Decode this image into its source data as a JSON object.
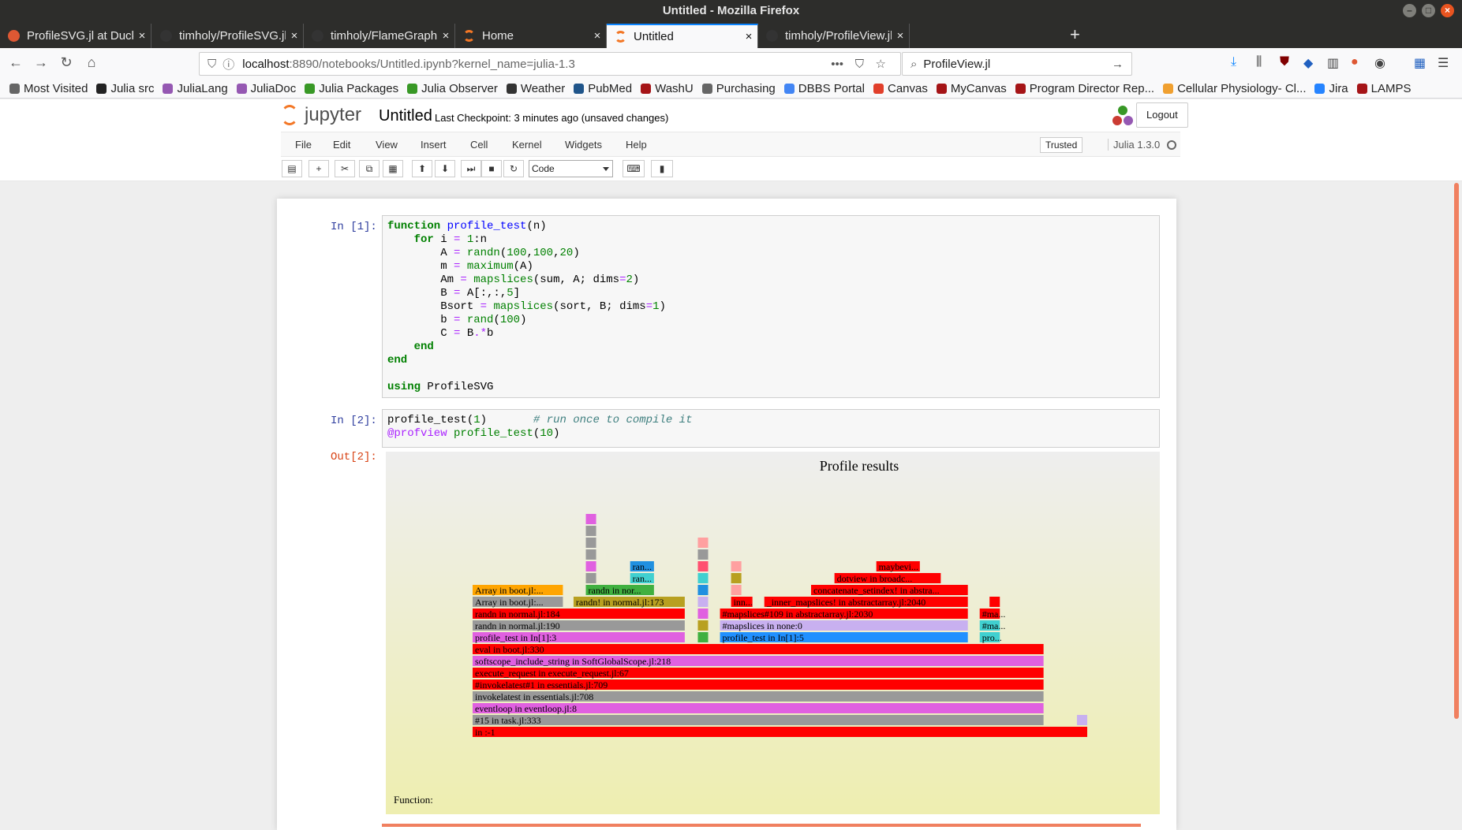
{
  "window": {
    "title": "Untitled - Mozilla Firefox"
  },
  "tabs": [
    {
      "label": "ProfileSVG.jl at DuckDuc",
      "icon": "duckduckgo-icon",
      "color": "#de5833"
    },
    {
      "label": "timholy/ProfileSVG.jl: W",
      "icon": "github-icon",
      "color": "#333333"
    },
    {
      "label": "timholy/FlameGraphs.jl:",
      "icon": "github-icon",
      "color": "#333333"
    },
    {
      "label": "Home",
      "icon": "jupyter-icon",
      "color": "#f37726"
    },
    {
      "label": "Untitled",
      "icon": "jupyter-icon",
      "color": "#f37726",
      "active": true
    },
    {
      "label": "timholy/ProfileView.jl: V",
      "icon": "github-icon",
      "color": "#333333"
    }
  ],
  "nav": {
    "url_host": "localhost",
    "url_rest": ":8890/notebooks/Untitled.ipynb?kernel_name=julia-1.3",
    "search_value": "ProfileView.jl"
  },
  "bookmarks": [
    {
      "label": "Most Visited",
      "color": "#666666"
    },
    {
      "label": "Julia src",
      "color": "#222222"
    },
    {
      "label": "JuliaLang",
      "color": "#9558b2"
    },
    {
      "label": "JuliaDoc",
      "color": "#9558b2"
    },
    {
      "label": "Julia Packages",
      "color": "#389826"
    },
    {
      "label": "Julia Observer",
      "color": "#389826"
    },
    {
      "label": "Weather",
      "color": "#333333"
    },
    {
      "label": "PubMed",
      "color": "#20558a"
    },
    {
      "label": "WashU",
      "color": "#a51417"
    },
    {
      "label": "Purchasing",
      "color": "#666666"
    },
    {
      "label": "DBBS Portal",
      "color": "#4285f4"
    },
    {
      "label": "Canvas",
      "color": "#e13f2b"
    },
    {
      "label": "MyCanvas",
      "color": "#a51417"
    },
    {
      "label": "Program Director Rep...",
      "color": "#a51417"
    },
    {
      "label": "Cellular Physiology- Cl...",
      "color": "#f0a030"
    },
    {
      "label": "Jira",
      "color": "#2684ff"
    },
    {
      "label": "LAMPS",
      "color": "#a51417"
    }
  ],
  "jupyter": {
    "logo_text": "jupyter",
    "notebook_name": "Untitled",
    "checkpoint": "Last Checkpoint: 3 minutes ago (unsaved changes)",
    "logout": "Logout",
    "menus": [
      "File",
      "Edit",
      "View",
      "Insert",
      "Cell",
      "Kernel",
      "Widgets",
      "Help"
    ],
    "trusted": "Trusted",
    "kernel": "Julia 1.3.0",
    "cell_type": "Code"
  },
  "cells": {
    "c1_prompt": "In [1]:",
    "c2_prompt": "In [2]:",
    "out_prompt": "Out[2]:"
  },
  "chart_data": {
    "type": "flamegraph",
    "title": "Profile results",
    "footer": "Function:",
    "frames": [
      {
        "label": "in :-1",
        "level": 0,
        "start": 0,
        "end": 100,
        "color": "#ff0000"
      },
      {
        "label": "#15 in task.jl:333",
        "level": 1,
        "start": 0,
        "end": 92.9,
        "color": "#999999"
      },
      {
        "label": "eventloop in eventloop.jl:8",
        "level": 2,
        "start": 0,
        "end": 92.9,
        "color": "#e060e0"
      },
      {
        "label": "invokelatest in essentials.jl:708",
        "level": 3,
        "start": 0,
        "end": 92.9,
        "color": "#999999"
      },
      {
        "label": "#invokelatest#1 in essentials.jl:709",
        "level": 4,
        "start": 0,
        "end": 92.9,
        "color": "#ff0000"
      },
      {
        "label": "execute_request in execute_request.jl:67",
        "level": 5,
        "start": 0,
        "end": 92.9,
        "color": "#ff0000"
      },
      {
        "label": "softscope_include_string in SoftGlobalScope.jl:218",
        "level": 6,
        "start": 0,
        "end": 92.9,
        "color": "#e060e0"
      },
      {
        "label": "eval in boot.jl:330",
        "level": 7,
        "start": 0,
        "end": 92.9,
        "color": "#ff0000"
      },
      {
        "label": "profile_test in In[1]:3",
        "level": 8,
        "start": 0,
        "end": 34.6,
        "color": "#e060e0"
      },
      {
        "label": "randn in normal.jl:190",
        "level": 9,
        "start": 0,
        "end": 34.6,
        "color": "#999999"
      },
      {
        "label": "randn in normal.jl:184",
        "level": 10,
        "start": 0,
        "end": 34.6,
        "color": "#ff0000"
      },
      {
        "label": "Array in boot.jl:...",
        "level": 11,
        "start": 0,
        "end": 14.8,
        "color": "#999999"
      },
      {
        "label": "Array in boot.jl:...",
        "level": 12,
        "start": 0,
        "end": 14.8,
        "color": "#ffa500"
      },
      {
        "label": "randn! in normal.jl:173",
        "level": 11,
        "start": 16.4,
        "end": 34.6,
        "color": "#b8a020"
      },
      {
        "label": "randn in nor...",
        "level": 12,
        "start": 18.4,
        "end": 29.6,
        "color": "#40b040"
      },
      {
        "label": "ran...",
        "level": 13,
        "start": 25.6,
        "end": 29.6,
        "color": "#40d0d0"
      },
      {
        "label": "ran...",
        "level": 14,
        "start": 25.6,
        "end": 29.6,
        "color": "#2090e0"
      },
      {
        "label": "",
        "level": 13,
        "start": 18.4,
        "end": 20.2,
        "color": "#999999"
      },
      {
        "label": "",
        "level": 14,
        "start": 18.4,
        "end": 20.2,
        "color": "#e060e0"
      },
      {
        "label": "",
        "level": 15,
        "start": 18.4,
        "end": 20.2,
        "color": "#999999"
      },
      {
        "label": "",
        "level": 16,
        "start": 18.4,
        "end": 20.2,
        "color": "#999999"
      },
      {
        "label": "",
        "level": 17,
        "start": 18.4,
        "end": 20.2,
        "color": "#999999"
      },
      {
        "label": "",
        "level": 18,
        "start": 18.4,
        "end": 20.2,
        "color": "#e060e0"
      },
      {
        "label": "",
        "level": 8,
        "start": 36.6,
        "end": 38.4,
        "color": "#40b040"
      },
      {
        "label": "",
        "level": 9,
        "start": 36.6,
        "end": 38.4,
        "color": "#b8a020"
      },
      {
        "label": "",
        "level": 10,
        "start": 36.6,
        "end": 38.4,
        "color": "#e060e0"
      },
      {
        "label": "",
        "level": 11,
        "start": 36.6,
        "end": 38.4,
        "color": "#c8b0f0"
      },
      {
        "label": "",
        "level": 12,
        "start": 36.6,
        "end": 38.4,
        "color": "#2090e0"
      },
      {
        "label": "",
        "level": 13,
        "start": 36.6,
        "end": 38.4,
        "color": "#40d0d0"
      },
      {
        "label": "",
        "level": 14,
        "start": 36.6,
        "end": 38.4,
        "color": "#ff5070"
      },
      {
        "label": "",
        "level": 15,
        "start": 36.6,
        "end": 38.4,
        "color": "#999999"
      },
      {
        "label": "",
        "level": 16,
        "start": 36.6,
        "end": 38.4,
        "color": "#ffa0a0"
      },
      {
        "label": "profile_test in In[1]:5",
        "level": 8,
        "start": 40.2,
        "end": 80.6,
        "color": "#2090ff"
      },
      {
        "label": "#mapslices in none:0",
        "level": 9,
        "start": 40.2,
        "end": 80.6,
        "color": "#c8b0f0"
      },
      {
        "label": "#mapslices#109 in abstractarray.jl:2030",
        "level": 10,
        "start": 40.2,
        "end": 80.6,
        "color": "#ff0000"
      },
      {
        "label": "inn...",
        "level": 11,
        "start": 42.0,
        "end": 45.6,
        "color": "#ff0000"
      },
      {
        "label": "",
        "level": 12,
        "start": 42.0,
        "end": 43.8,
        "color": "#ffa0a0"
      },
      {
        "label": "",
        "level": 13,
        "start": 42.0,
        "end": 43.8,
        "color": "#b8a020"
      },
      {
        "label": "",
        "level": 14,
        "start": 42.0,
        "end": 43.8,
        "color": "#ffa0a0"
      },
      {
        "label": "_inner_mapslices! in abstractarray.jl:2040",
        "level": 11,
        "start": 47.4,
        "end": 80.6,
        "color": "#ff0000"
      },
      {
        "label": "concatenate_setindex! in abstra...",
        "level": 12,
        "start": 55.0,
        "end": 80.6,
        "color": "#ff0000"
      },
      {
        "label": "dotview in broadc...",
        "level": 13,
        "start": 58.8,
        "end": 76.2,
        "color": "#ff0000"
      },
      {
        "label": "maybevi...",
        "level": 14,
        "start": 65.6,
        "end": 72.8,
        "color": "#ff0000"
      },
      {
        "label": "pro...",
        "level": 8,
        "start": 82.4,
        "end": 85.8,
        "color": "#40d0d0"
      },
      {
        "label": "#ma...",
        "level": 9,
        "start": 82.4,
        "end": 85.8,
        "color": "#40d0d0"
      },
      {
        "label": "#ma...",
        "level": 10,
        "start": 82.4,
        "end": 85.8,
        "color": "#ff0000"
      },
      {
        "label": "",
        "level": 11,
        "start": 84.0,
        "end": 85.8,
        "color": "#ff0000"
      },
      {
        "label": "",
        "level": 1,
        "start": 98.2,
        "end": 100,
        "color": "#c8b0f0"
      }
    ]
  }
}
